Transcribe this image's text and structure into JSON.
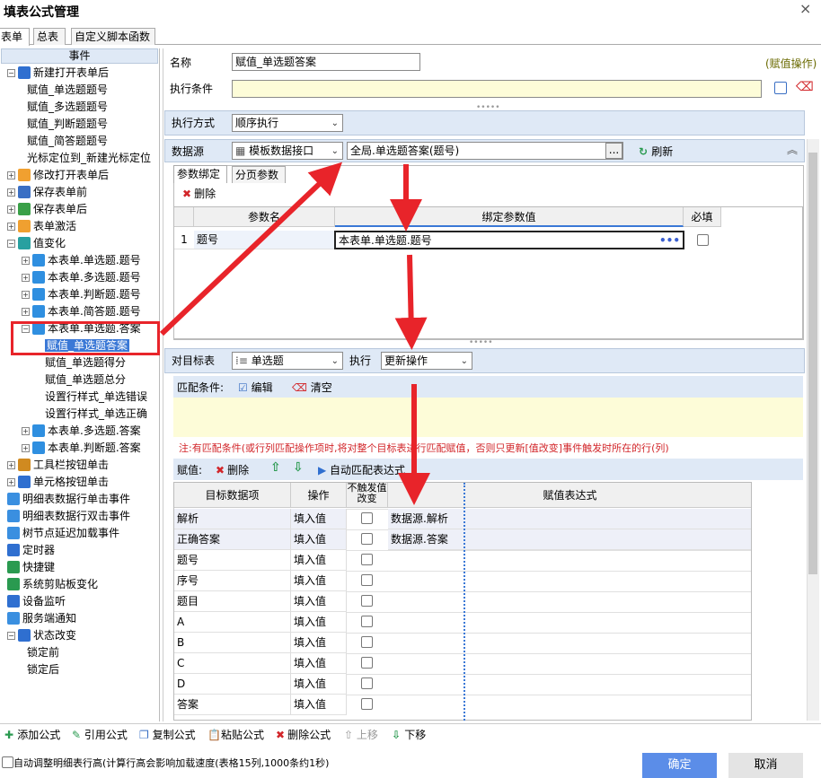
{
  "window": {
    "title": "填表公式管理",
    "close": "×"
  },
  "tabs": [
    {
      "label": "表单"
    },
    {
      "label": "总表"
    },
    {
      "label": "自定义脚本函数"
    }
  ],
  "left": {
    "header": "事件",
    "tree": [
      {
        "text": "新建打开表单后",
        "pm": "⊟",
        "color": "#2f6fd0"
      },
      {
        "text": "赋值_单选题题号"
      },
      {
        "text": "赋值_多选题题号"
      },
      {
        "text": "赋值_判断题题号"
      },
      {
        "text": "赋值_简答题题号"
      },
      {
        "text": "光标定位到_新建光标定位"
      },
      {
        "text": "修改打开表单后",
        "pm": "⊞",
        "color": "#f0a030"
      },
      {
        "text": "保存表单前",
        "pm": "⊞",
        "color": "#3a6fc4"
      },
      {
        "text": "保存表单后",
        "pm": "⊞",
        "color": "#3aa048"
      },
      {
        "text": "表单激活",
        "pm": "⊞",
        "color": "#f0a030"
      },
      {
        "text": "值变化",
        "pm": "⊟",
        "color": "#28a0a0"
      },
      {
        "text": "本表单.单选题.题号",
        "pm": "⊞",
        "color": "#2f8fe0"
      },
      {
        "text": "本表单.多选题.题号",
        "pm": "⊞",
        "color": "#2f8fe0"
      },
      {
        "text": "本表单.判断题.题号",
        "pm": "⊞",
        "color": "#2f8fe0"
      },
      {
        "text": "本表单.简答题.题号",
        "pm": "⊞",
        "color": "#2f8fe0"
      },
      {
        "text": "本表单.单选题.答案",
        "pm": "⊟",
        "color": "#2f8fe0"
      },
      {
        "text": "赋值_单选题答案",
        "selected": true
      },
      {
        "text": "赋值_单选题得分"
      },
      {
        "text": "赋值_单选题总分"
      },
      {
        "text": "设置行样式_单选错误"
      },
      {
        "text": "设置行样式_单选正确"
      },
      {
        "text": "本表单.多选题.答案",
        "pm": "⊞",
        "color": "#2f8fe0"
      },
      {
        "text": "本表单.判断题.答案",
        "pm": "⊞",
        "color": "#2f8fe0"
      },
      {
        "text": "工具栏按钮单击",
        "pm": "⊞",
        "color": "#d08a20"
      },
      {
        "text": "单元格按钮单击",
        "pm": "⊞",
        "color": "#2f6fd0"
      },
      {
        "text": "明细表数据行单击事件",
        "color": "#3a8fe0"
      },
      {
        "text": "明细表数据行双击事件",
        "color": "#3a8fe0"
      },
      {
        "text": "树节点延迟加载事件",
        "color": "#3a8fe0"
      },
      {
        "text": "定时器",
        "color": "#2f6fd0"
      },
      {
        "text": "快捷键",
        "color": "#2a9a50"
      },
      {
        "text": "系统剪贴板变化",
        "color": "#2a9a50"
      },
      {
        "text": "设备监听",
        "color": "#2f6fd0"
      },
      {
        "text": "服务端通知",
        "color": "#3a8fe0"
      },
      {
        "text": "状态改变",
        "pm": "⊟",
        "color": "#2f6fd0"
      },
      {
        "text": "锁定前"
      },
      {
        "text": "锁定后"
      }
    ]
  },
  "form": {
    "name_label": "名称",
    "name_value": "赋值_单选题答案",
    "type_label": "(赋值操作)",
    "cond_label": "执行条件",
    "cond_value": "",
    "exec_mode_label": "执行方式",
    "exec_mode_value": "顺序执行",
    "datasource_label": "数据源",
    "datasource_value": "模板数据接口",
    "datasource_path": "全局.单选题答案(题号)",
    "browse": "...",
    "refresh": "刷新",
    "subtabs": [
      "参数绑定",
      "分页参数"
    ],
    "delete": "删除",
    "param_headers": [
      "参数名",
      "绑定参数值",
      "必填"
    ],
    "param_rows": [
      {
        "no": "1",
        "name": "题号",
        "value": "本表单.单选题.题号"
      }
    ],
    "target_label": "对目标表",
    "target_value": "单选题",
    "exec_label": "执行",
    "exec_value": "更新操作",
    "match_label": "匹配条件:",
    "edit": "编辑",
    "clear": "清空",
    "note": "注:有匹配条件(或行列匹配操作项时,将对整个目标表进行匹配赋值，否则只更新[值改变]事件触发时所在的行(列)",
    "assign_label": "赋值:",
    "auto_match": "自动匹配表达式",
    "assign_headers": [
      "目标数据项",
      "操作",
      "不触发值改变",
      "赋值表达式"
    ],
    "assign_rows": [
      {
        "item": "解析",
        "op": "填入值",
        "expr": "数据源.解析"
      },
      {
        "item": "正确答案",
        "op": "填入值",
        "expr": "数据源.答案"
      },
      {
        "item": "题号",
        "op": "填入值",
        "expr": ""
      },
      {
        "item": "序号",
        "op": "填入值",
        "expr": ""
      },
      {
        "item": "题目",
        "op": "填入值",
        "expr": ""
      },
      {
        "item": "A",
        "op": "填入值",
        "expr": ""
      },
      {
        "item": "B",
        "op": "填入值",
        "expr": ""
      },
      {
        "item": "C",
        "op": "填入值",
        "expr": ""
      },
      {
        "item": "D",
        "op": "填入值",
        "expr": ""
      },
      {
        "item": "答案",
        "op": "填入值",
        "expr": ""
      }
    ]
  },
  "bottom": {
    "add": "添加公式",
    "ref": "引用公式",
    "copy": "复制公式",
    "paste": "粘贴公式",
    "del": "删除公式",
    "up": "上移",
    "down": "下移",
    "auto_row": "自动调整明细表行高(计算行高会影响加载速度(表格15列,1000条约1秒)",
    "ok": "确定",
    "cancel": "取消"
  }
}
